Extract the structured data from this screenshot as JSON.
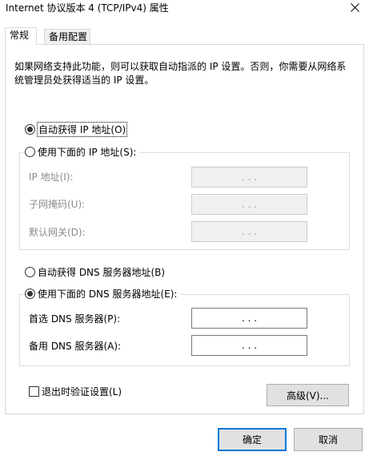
{
  "window": {
    "title": "Internet 协议版本 4 (TCP/IPv4) 属性",
    "close_glyph": "✕"
  },
  "tabs": [
    {
      "label": "常规",
      "active": true
    },
    {
      "label": "备用配置",
      "active": false
    }
  ],
  "description": "如果网络支持此功能，则可以获取自动指派的 IP 设置。否则，你需要从网络系统管理员处获得适当的 IP 设置。",
  "ip_section": {
    "auto_option": {
      "label": "自动获得 IP 地址(O)",
      "checked": true
    },
    "manual_option": {
      "label": "使用下面的 IP 地址(S):",
      "checked": false
    },
    "fields": [
      {
        "label": "IP 地址(I):",
        "value": ". . .",
        "enabled": false
      },
      {
        "label": "子网掩码(U):",
        "value": ". . .",
        "enabled": false
      },
      {
        "label": "默认网关(D):",
        "value": ". . .",
        "enabled": false
      }
    ]
  },
  "dns_section": {
    "auto_option": {
      "label": "自动获得 DNS 服务器地址(B)",
      "checked": false
    },
    "manual_option": {
      "label": "使用下面的 DNS 服务器地址(E):",
      "checked": true
    },
    "fields": [
      {
        "label": "首选 DNS 服务器(P):",
        "value": ". . .",
        "enabled": true
      },
      {
        "label": "备用 DNS 服务器(A):",
        "value": ". . .",
        "enabled": true
      }
    ]
  },
  "validate_on_exit": {
    "label": "退出时验证设置(L)",
    "checked": false
  },
  "buttons": {
    "advanced": "高级(V)...",
    "ok": "确定",
    "cancel": "取消"
  },
  "colors": {
    "default_button_border": "#0078d7",
    "button_face": "#e1e1e1",
    "disabled_text": "#8a8a8a"
  }
}
